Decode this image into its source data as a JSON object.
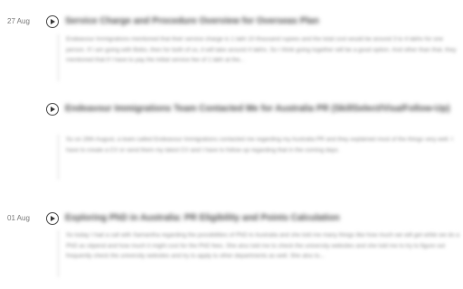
{
  "entries": [
    {
      "date": "27 Aug",
      "title": "Service Charge and Procedure Overview for Overseas Plan",
      "body": "Endeavour Immigrations mentioned that their service charge is 1 lakh 10 thousand rupees and the total cost would be around 3 to 4 lakhs for one person. If I am going with Bebo, then for both of us, it will take around 4 lakhs. So I think going together will be a good option. And other than that, they mentioned that if I have to pay the initial service fee of 1 lakh at the..."
    },
    {
      "date": "",
      "title": "Endeavour Immigrations Team Contacted Me for Australia PR (SkillSelect/Visa/Follow-Up)",
      "body": "So on 26th August, a team called Endeavour Immigrations contacted me regarding my Australia PR and they explained most of the things very well. I have to create a CV or send them my latest CV and I have to follow up regarding that in the coming days."
    },
    {
      "date": "01 Aug",
      "title": "Exploring PhD in Australia: PR Eligibility and Points Calculation",
      "body": "So today I had a call with Samantha regarding the possibilities of PhD in Australia and she told me many things like how much we will get while we do a PhD as stipend and how much it might cost for the PhD fees. She also told me to check the university websites and she told me to try to figure out frequently check the university websites and try to apply to other departments as well. She also to..."
    }
  ]
}
